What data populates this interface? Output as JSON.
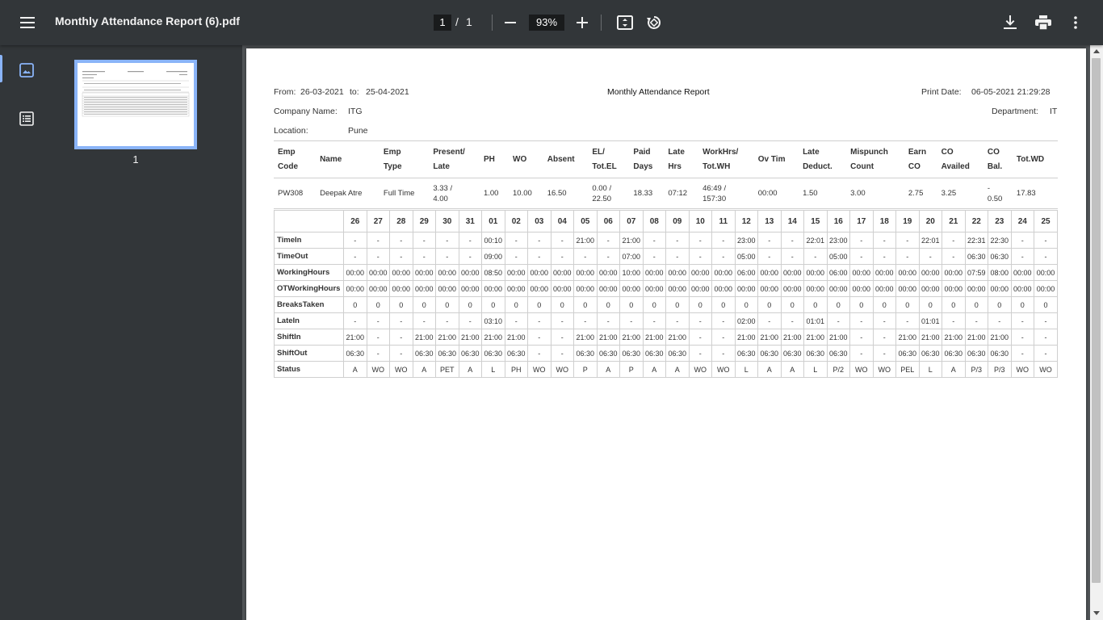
{
  "toolbar": {
    "title": "Monthly Attendance Report (6).pdf",
    "current_page": "1",
    "page_sep": "/",
    "total_pages": "1",
    "zoom": "93%"
  },
  "sidebar": {
    "thumb_page": "1"
  },
  "report": {
    "from_label": "From:",
    "from": "26-03-2021",
    "to_label": "to:",
    "to": "25-04-2021",
    "title": "Monthly Attendance Report",
    "print_label": "Print Date:",
    "print_date": "06-05-2021 21:29:28",
    "company_label": "Company Name:",
    "company": "ITG",
    "department_label": "Department:",
    "department": "IT",
    "location_label": "Location:",
    "location": "Pune"
  },
  "summary": {
    "headers": [
      [
        "Emp",
        "Code"
      ],
      [
        "Name"
      ],
      [
        "Emp",
        "Type"
      ],
      [
        "Present/",
        "Late"
      ],
      [
        "PH"
      ],
      [
        "WO"
      ],
      [
        "Absent"
      ],
      [
        "EL/",
        "Tot.EL"
      ],
      [
        "Paid",
        "Days"
      ],
      [
        "Late",
        "Hrs"
      ],
      [
        "WorkHrs/",
        "Tot.WH"
      ],
      [
        "Ov Tim"
      ],
      [
        "Late",
        "Deduct."
      ],
      [
        "Mispunch",
        "Count"
      ],
      [
        "Earn",
        "CO"
      ],
      [
        "CO",
        "Availed"
      ],
      [
        "CO",
        "Bal."
      ],
      [
        "Tot.WD"
      ]
    ],
    "row": [
      [
        "PW308"
      ],
      [
        "Deepak Atre"
      ],
      [
        "Full Time"
      ],
      [
        "3.33 /",
        "4.00"
      ],
      [
        "1.00"
      ],
      [
        "10.00"
      ],
      [
        "16.50"
      ],
      [
        "0.00 /",
        "22.50"
      ],
      [
        "18.33"
      ],
      [
        "07:12"
      ],
      [
        "46:49 /",
        "157:30"
      ],
      [
        "00:00"
      ],
      [
        "1.50"
      ],
      [
        "3.00"
      ],
      [
        "2.75"
      ],
      [
        "3.25"
      ],
      [
        "-",
        "0.50"
      ],
      [
        "17.83"
      ]
    ]
  },
  "daily": {
    "days": [
      "26",
      "27",
      "28",
      "29",
      "30",
      "31",
      "01",
      "02",
      "03",
      "04",
      "05",
      "06",
      "07",
      "08",
      "09",
      "10",
      "11",
      "12",
      "13",
      "14",
      "15",
      "16",
      "17",
      "18",
      "19",
      "20",
      "21",
      "22",
      "23",
      "24",
      "25"
    ],
    "rows": [
      {
        "label": "TimeIn",
        "values": [
          "-",
          "-",
          "-",
          "-",
          "-",
          "-",
          "00:10",
          "-",
          "-",
          "-",
          "21:00",
          "-",
          "21:00",
          "-",
          "-",
          "-",
          "-",
          "23:00",
          "-",
          "-",
          "22:01",
          "23:00",
          "-",
          "-",
          "-",
          "22:01",
          "-",
          "22:31",
          "22:30",
          "-",
          "-"
        ]
      },
      {
        "label": "TimeOut",
        "values": [
          "-",
          "-",
          "-",
          "-",
          "-",
          "-",
          "09:00",
          "-",
          "-",
          "-",
          "-",
          "-",
          "07:00",
          "-",
          "-",
          "-",
          "-",
          "05:00",
          "-",
          "-",
          "-",
          "05:00",
          "-",
          "-",
          "-",
          "-",
          "-",
          "06:30",
          "06:30",
          "-",
          "-"
        ]
      },
      {
        "label": "WorkingHours",
        "values": [
          "00:00",
          "00:00",
          "00:00",
          "00:00",
          "00:00",
          "00:00",
          "08:50",
          "00:00",
          "00:00",
          "00:00",
          "00:00",
          "00:00",
          "10:00",
          "00:00",
          "00:00",
          "00:00",
          "00:00",
          "06:00",
          "00:00",
          "00:00",
          "00:00",
          "06:00",
          "00:00",
          "00:00",
          "00:00",
          "00:00",
          "00:00",
          "07:59",
          "08:00",
          "00:00",
          "00:00"
        ]
      },
      {
        "label": "OTWorkingHours",
        "values": [
          "00:00",
          "00:00",
          "00:00",
          "00:00",
          "00:00",
          "00:00",
          "00:00",
          "00:00",
          "00:00",
          "00:00",
          "00:00",
          "00:00",
          "00:00",
          "00:00",
          "00:00",
          "00:00",
          "00:00",
          "00:00",
          "00:00",
          "00:00",
          "00:00",
          "00:00",
          "00:00",
          "00:00",
          "00:00",
          "00:00",
          "00:00",
          "00:00",
          "00:00",
          "00:00",
          "00:00"
        ]
      },
      {
        "label": "BreaksTaken",
        "values": [
          "0",
          "0",
          "0",
          "0",
          "0",
          "0",
          "0",
          "0",
          "0",
          "0",
          "0",
          "0",
          "0",
          "0",
          "0",
          "0",
          "0",
          "0",
          "0",
          "0",
          "0",
          "0",
          "0",
          "0",
          "0",
          "0",
          "0",
          "0",
          "0",
          "0",
          "0"
        ]
      },
      {
        "label": "LateIn",
        "values": [
          "-",
          "-",
          "-",
          "-",
          "-",
          "-",
          "03:10",
          "-",
          "-",
          "-",
          "-",
          "-",
          "-",
          "-",
          "-",
          "-",
          "-",
          "02:00",
          "-",
          "-",
          "01:01",
          "-",
          "-",
          "-",
          "-",
          "01:01",
          "-",
          "-",
          "-",
          "-",
          "-"
        ]
      },
      {
        "label": "ShiftIn",
        "values": [
          "21:00",
          "-",
          "-",
          "21:00",
          "21:00",
          "21:00",
          "21:00",
          "21:00",
          "-",
          "-",
          "21:00",
          "21:00",
          "21:00",
          "21:00",
          "21:00",
          "-",
          "-",
          "21:00",
          "21:00",
          "21:00",
          "21:00",
          "21:00",
          "-",
          "-",
          "21:00",
          "21:00",
          "21:00",
          "21:00",
          "21:00",
          "-",
          "-"
        ]
      },
      {
        "label": "ShiftOut",
        "values": [
          "06:30",
          "-",
          "-",
          "06:30",
          "06:30",
          "06:30",
          "06:30",
          "06:30",
          "-",
          "-",
          "06:30",
          "06:30",
          "06:30",
          "06:30",
          "06:30",
          "-",
          "-",
          "06:30",
          "06:30",
          "06:30",
          "06:30",
          "06:30",
          "-",
          "-",
          "06:30",
          "06:30",
          "06:30",
          "06:30",
          "06:30",
          "-",
          "-"
        ]
      },
      {
        "label": "Status",
        "values": [
          "A",
          "WO",
          "WO",
          "A",
          "PET",
          "A",
          "L",
          "PH",
          "WO",
          "WO",
          "P",
          "A",
          "P",
          "A",
          "A",
          "WO",
          "WO",
          "L",
          "A",
          "A",
          "L",
          "P/2",
          "WO",
          "WO",
          "PEL",
          "L",
          "A",
          "P/3",
          "P/3",
          "WO",
          "WO"
        ]
      }
    ]
  }
}
